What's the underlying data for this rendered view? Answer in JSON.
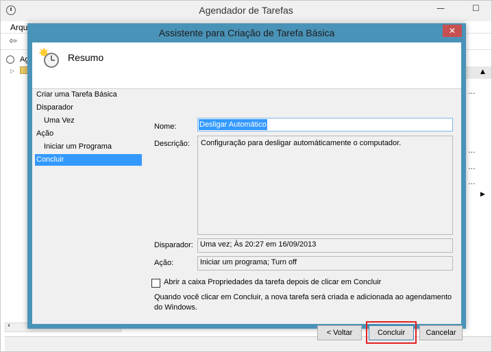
{
  "main_window": {
    "title": "Agendador de Tarefas",
    "menu_first": "Arqu",
    "tree_item": "Ag",
    "controls": {
      "minimize": "—",
      "maximize": "☐"
    }
  },
  "dialog": {
    "title": "Assistente para Criação de Tarefa Básica",
    "close_symbol": "✕",
    "header_title": "Resumo",
    "steps": [
      {
        "label": "Criar uma Tarefa Básica"
      },
      {
        "label": "Disparador"
      },
      {
        "label": "Uma Vez"
      },
      {
        "label": "Ação"
      },
      {
        "label": "Iniciar um Programa"
      },
      {
        "label": "Concluir"
      }
    ],
    "labels": {
      "name": "Nome:",
      "description": "Descrição:",
      "trigger": "Disparador:",
      "action": "Ação:"
    },
    "values": {
      "name": "Desligar Automático",
      "description": "Configuração para desligar automáticamente o computador.",
      "trigger": "Uma vez; Às 20:27 em 16/09/2013",
      "action": "Iniciar um programa; Turn off"
    },
    "checkbox_label": "Abrir a caixa Propriedades da tarefa depois de clicar em Concluir",
    "info_text": "Quando você clicar em Concluir, a nova tarefa será criada e adicionada ao agendamento do Windows.",
    "buttons": {
      "back": "< Voltar",
      "finish": "Concluir",
      "cancel": "Cancelar"
    }
  },
  "colors": {
    "dialog_frame": "#4a93b8",
    "selection": "#3399ff",
    "close_button": "#c75050",
    "highlight_border": "#e02020"
  }
}
